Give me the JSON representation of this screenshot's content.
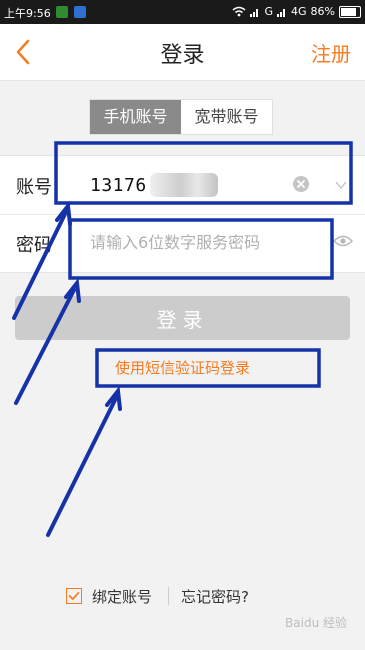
{
  "status_bar": {
    "time": "上午9:56",
    "network_label_1": "G",
    "network_label_2": "4G",
    "battery": "86%",
    "battery_level": 0.86
  },
  "nav": {
    "title": "登录",
    "register": "注册",
    "accent_color": "#f57c22"
  },
  "tabs": [
    {
      "label": "手机账号",
      "active": true
    },
    {
      "label": "宽带账号",
      "active": false
    }
  ],
  "account_field": {
    "label": "账号",
    "value": "13176"
  },
  "password_field": {
    "label": "密码",
    "placeholder": "请输入6位数字服务密码"
  },
  "login_button": {
    "label": "登录"
  },
  "sms_login": {
    "label": "使用短信验证码登录"
  },
  "bottom": {
    "bind_label": "绑定账号",
    "forgot_label": "忘记密码?"
  },
  "watermark": {
    "text": "Baidu 经验"
  },
  "annotations": {
    "color": "#1632a8"
  }
}
